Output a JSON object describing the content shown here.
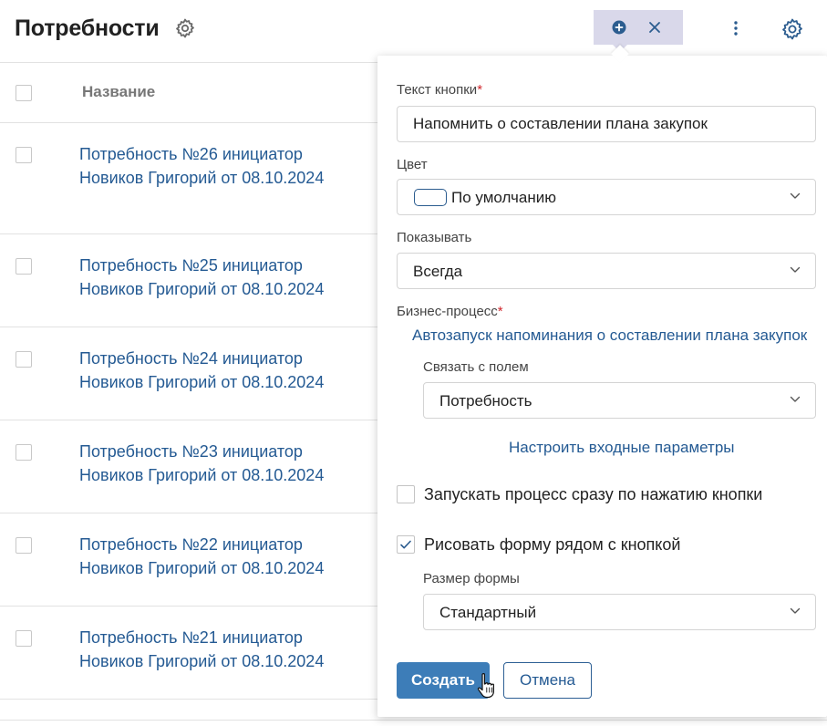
{
  "header": {
    "title": "Потребности",
    "title_settings_icon": "gear-icon",
    "toolbar": {
      "add_icon": "plus-circle-icon",
      "close_icon": "close-icon",
      "more_icon": "more-vertical-icon",
      "settings_icon": "gear-icon"
    }
  },
  "table": {
    "columns": [
      "Название"
    ],
    "rows": [
      {
        "line1": "Потребность №26 инициатор",
        "line2": "Новиков Григорий от 08.10.2024"
      },
      {
        "line1": "Потребность №25 инициатор",
        "line2": "Новиков Григорий от 08.10.2024"
      },
      {
        "line1": "Потребность №24 инициатор",
        "line2": "Новиков Григорий от 08.10.2024"
      },
      {
        "line1": "Потребность №23 инициатор",
        "line2": "Новиков Григорий от 08.10.2024"
      },
      {
        "line1": "Потребность №22 инициатор",
        "line2": "Новиков Григорий от 08.10.2024"
      },
      {
        "line1": "Потребность №21 инициатор",
        "line2": "Новиков Григорий от 08.10.2024"
      }
    ]
  },
  "popup": {
    "button_text": {
      "label": "Текст кнопки",
      "required_mark": "*",
      "value": "Напомнить о составлении плана закупок"
    },
    "color": {
      "label": "Цвет",
      "value": "По умолчанию"
    },
    "show": {
      "label": "Показывать",
      "value": "Всегда"
    },
    "business_process": {
      "label": "Бизнес-процесс",
      "required_mark": "*",
      "link": "Автозапуск напоминания о составлении плана закупок"
    },
    "link_field": {
      "label": "Связать с полем",
      "value": "Потребность"
    },
    "configure_link": "Настроить входные параметры",
    "run_immediately": {
      "label": "Запускать процесс сразу по нажатию кнопки",
      "checked": false
    },
    "draw_form": {
      "label": "Рисовать форму рядом с кнопкой",
      "checked": true
    },
    "form_size": {
      "label": "Размер формы",
      "value": "Стандартный"
    },
    "buttons": {
      "create": "Создать",
      "cancel": "Отмена"
    }
  },
  "colors": {
    "link": "#245a93",
    "primary_button": "#3d7db8",
    "toolbar_highlight": "#d9d8ea",
    "required": "#d0252b"
  }
}
